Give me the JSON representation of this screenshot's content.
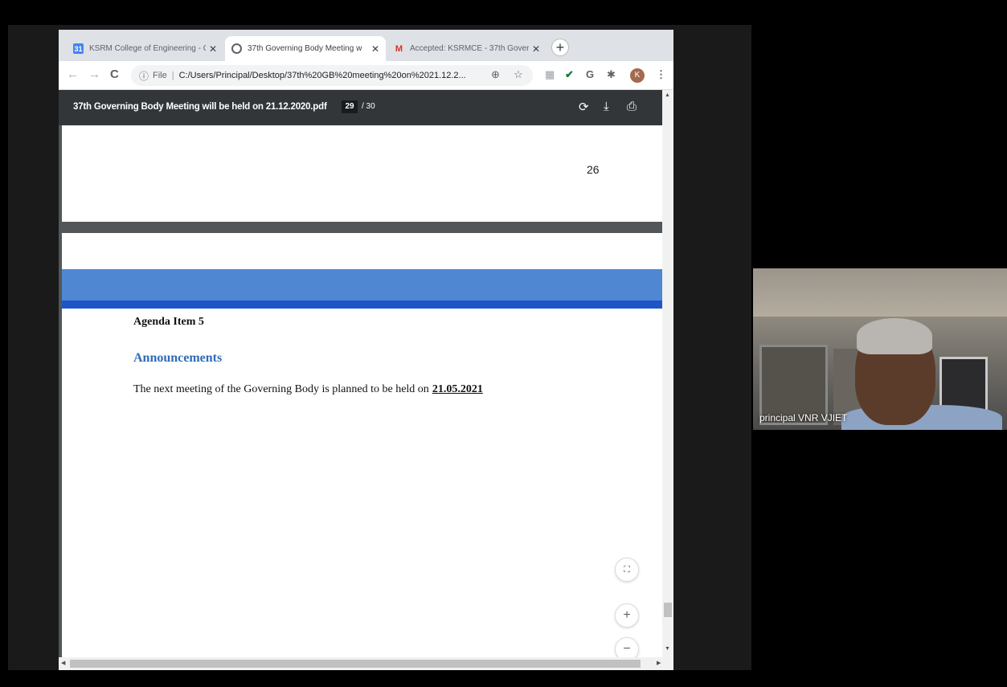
{
  "tabs": [
    {
      "title": "KSRM College of Engineering - C",
      "favicon": "calendar-favicon",
      "active": false
    },
    {
      "title": "37th Governing Body Meeting w",
      "favicon": "chrome-favicon",
      "active": true
    },
    {
      "title": "Accepted: KSRMCE - 37th Gover",
      "favicon": "gmail-favicon",
      "active": false
    }
  ],
  "newtab_label": "+",
  "toolbar": {
    "back": "←",
    "forward": "→",
    "reload": "C",
    "info": "ⓘ",
    "scheme": "File",
    "url": "C:/Users/Principal/Desktop/37th%20GB%20meeting%20on%2021.12.2...",
    "avatar": "K"
  },
  "pdf": {
    "filename": "37th Governing Body Meeting will be held on 21.12.2020.pdf",
    "current_page": "29",
    "total_pages": "/ 30",
    "page_number_previous": "26",
    "agenda_item": "Agenda Item 5",
    "section_heading": "Announcements",
    "next_meeting_text": "The next meeting of the Governing Body is planned to be held on",
    "next_meeting_date": "21.05.2021"
  },
  "participant": {
    "name": "principal VNR VJIET"
  },
  "colors": {
    "pdf_toolbar": "#323639",
    "band_blue": "#4f87d3",
    "heading_blue": "#2f6bb7"
  }
}
